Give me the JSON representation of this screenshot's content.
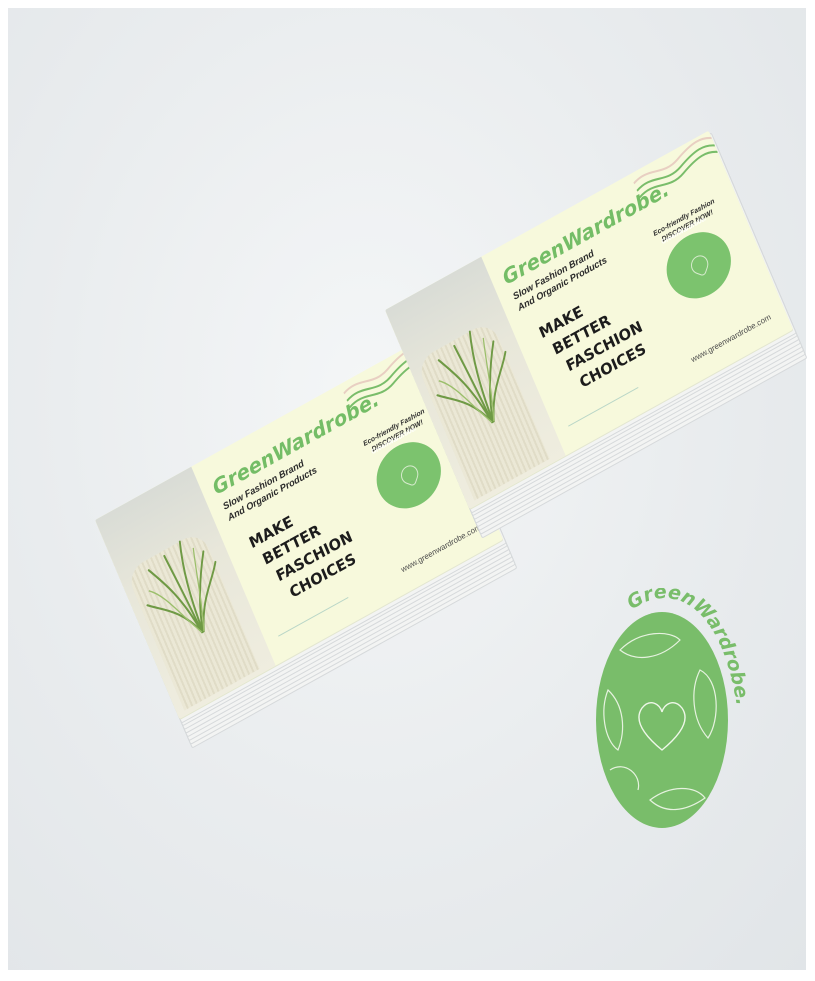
{
  "brand": {
    "name": "GreenWardrobe.",
    "tagline_line1": "Slow Fashion Brand",
    "tagline_line2": "And Organic Products",
    "headline": [
      "MAKE",
      "BETTER",
      "FASCHION",
      "CHOICES"
    ],
    "eco_line1": "Eco-friendly Fashion",
    "eco_line2": "DISCOVER NOW!",
    "url": "www.greenwardrobe.com"
  },
  "colors": {
    "brand_green": "#79bd6a",
    "card_background": "#f7f9dc",
    "text_dark": "#1c1c1c",
    "accent_pink": "#e8cfc2"
  },
  "icons": {
    "seal_heart": "heart-icon",
    "seal_leaves": "leaf-icon"
  }
}
